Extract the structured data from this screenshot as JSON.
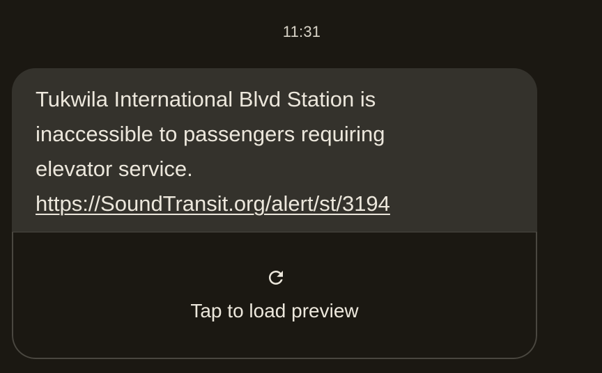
{
  "timestamp": "11:31",
  "message": {
    "text": "Tukwila International Blvd Station is inaccessible to passengers requiring elevator service.",
    "link": "https://SoundTransit.org/alert/st/3194"
  },
  "preview": {
    "icon": "refresh-icon",
    "label": "Tap to load preview"
  }
}
